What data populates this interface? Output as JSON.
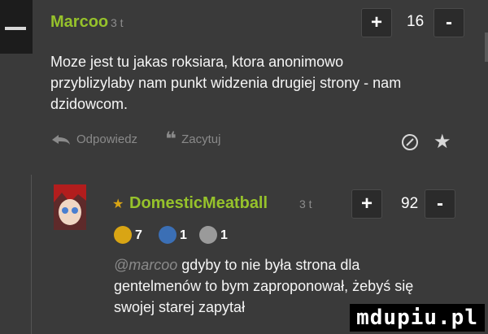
{
  "comment1": {
    "username": "Marcoo",
    "time": "3 t",
    "plus": "+",
    "score": "16",
    "minus": "-",
    "text_lines": [
      "Moze jest tu jakas roksiara, ktora anonimowo",
      "przyblizylaby nam punkt widzenia drugiej strony - nam",
      "dzidowcom."
    ],
    "reply_label": "Odpowiedz",
    "quote_label": "Zacytuj"
  },
  "comment2": {
    "star": "★",
    "username": "DomesticMeatball",
    "time": "3 t",
    "plus": "+",
    "score": "92",
    "minus": "-",
    "badges": [
      {
        "icon": "smile-badge-icon",
        "count": "7",
        "color": "#d9a514"
      },
      {
        "icon": "blue-badge-icon",
        "count": "1",
        "color": "#3b6fb5"
      },
      {
        "icon": "grey-badge-icon",
        "count": "1",
        "color": "#9a9a9a"
      }
    ],
    "mention": "@marcoo",
    "text_first": " gdyby to nie była strona dla",
    "text_lines": [
      "gentelmenów to bym zaproponował, żebyś się",
      "swojej starej zapytał"
    ]
  },
  "watermark": "mdupiu.pl",
  "colors": {
    "accent": "#96c22b",
    "background": "#3a3a3a",
    "muted": "#8a8a8a"
  }
}
